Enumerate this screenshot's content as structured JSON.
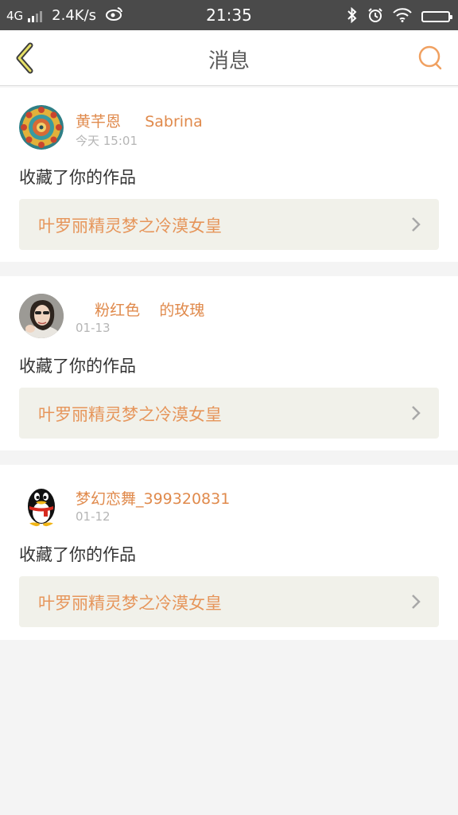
{
  "status_bar": {
    "network": "4G",
    "speed": "2.4K/s",
    "time": "21:35"
  },
  "navbar": {
    "title": "消息"
  },
  "messages": [
    {
      "sender": "黄芊恩     Sabrina",
      "time": "今天 15:01",
      "action": "收藏了你的作品",
      "work_title": "叶罗丽精灵梦之冷漠女皇"
    },
    {
      "sender": "    粉红色    的玫瑰",
      "time": "01-13",
      "action": "收藏了你的作品",
      "work_title": "叶罗丽精灵梦之冷漠女皇"
    },
    {
      "sender": "梦幻恋舞_399320831",
      "time": "01-12",
      "action": "收藏了你的作品",
      "work_title": "叶罗丽精灵梦之冷漠女皇"
    }
  ],
  "colors": {
    "accent": "#e08a4c",
    "link_bg": "#f1f1ea",
    "status_bar": "#4a4a4a"
  },
  "icons": {
    "back": "chevron-left-icon",
    "search": "search-icon",
    "chevron": "chevron-right-icon"
  }
}
